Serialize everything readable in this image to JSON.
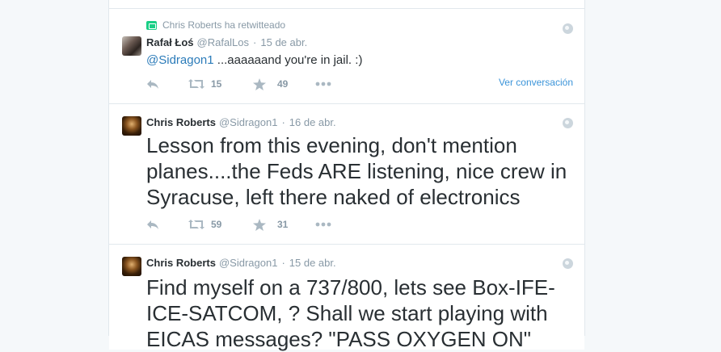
{
  "tweets": [
    {
      "retweeted_by": "Chris Roberts ha retwitteado",
      "name": "Rafał Łoś",
      "handle": "@RafalLos",
      "separator": "·",
      "date": "15 de abr.",
      "mention": "@Sidragon1",
      "text": " ...aaaaaand you're in jail. :)",
      "retweets": "15",
      "favorites": "49",
      "conversation_link": "Ver conversación"
    },
    {
      "name": "Chris Roberts",
      "handle": "@Sidragon1",
      "separator": "·",
      "date": "16 de abr.",
      "text": "Lesson from this evening, don't mention planes....the Feds ARE listening, nice crew in Syracuse, left there naked of electronics",
      "retweets": "59",
      "favorites": "31"
    },
    {
      "name": "Chris Roberts",
      "handle": "@Sidragon1",
      "separator": "·",
      "date": "15 de abr.",
      "text": "Find myself on a 737/800, lets see Box-IFE-ICE-SATCOM, ?  Shall we start playing with EICAS messages? \"PASS OXYGEN ON\""
    }
  ],
  "colors": {
    "accent": "#3b94d9",
    "mention": "#2b7bb9",
    "retweet_green": "#19cf86",
    "meta_gray": "#8899a6"
  }
}
